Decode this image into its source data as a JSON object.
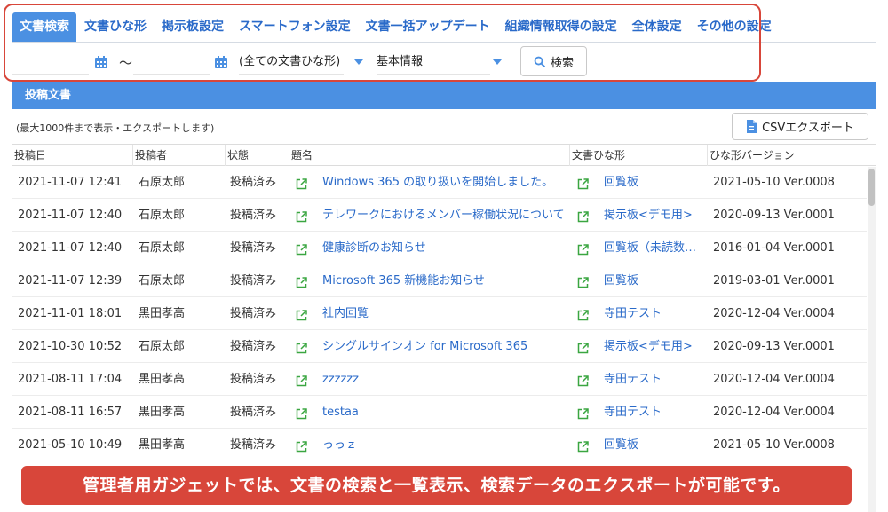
{
  "tabs": [
    {
      "label": "文書検索",
      "active": true
    },
    {
      "label": "文書ひな形",
      "active": false
    },
    {
      "label": "掲示板設定",
      "active": false
    },
    {
      "label": "スマートフォン設定",
      "active": false
    },
    {
      "label": "文書一括アップデート",
      "active": false
    },
    {
      "label": "組織情報取得の設定",
      "active": false
    },
    {
      "label": "全体設定",
      "active": false
    },
    {
      "label": "その他の設定",
      "active": false
    }
  ],
  "search": {
    "date_from": "",
    "date_separator": "〜",
    "date_to": "",
    "template_select": "(全ての文書ひな形)",
    "info_select": "基本情報",
    "search_button": "検索"
  },
  "section": {
    "title": "投稿文書",
    "note": "(最大1000件まで表示・エクスポートします)",
    "csv_button": "CSVエクスポート"
  },
  "table": {
    "headers": [
      "投稿日",
      "投稿者",
      "状態",
      "題名",
      "文書ひな形",
      "ひな形バージョン"
    ],
    "rows": [
      [
        "2021-11-07 12:41",
        "石原太郎",
        "投稿済み",
        "Windows 365 の取り扱いを開始しました。",
        "回覧板",
        "2021-05-10 Ver.0008"
      ],
      [
        "2021-11-07 12:40",
        "石原太郎",
        "投稿済み",
        "テレワークにおけるメンバー稼働状況について",
        "掲示板<デモ用>",
        "2020-09-13 Ver.0001"
      ],
      [
        "2021-11-07 12:40",
        "石原太郎",
        "投稿済み",
        "健康診断のお知らせ",
        "回覧板（未読数…",
        "2016-01-04 Ver.0001"
      ],
      [
        "2021-11-07 12:39",
        "石原太郎",
        "投稿済み",
        "Microsoft 365 新機能お知らせ",
        "回覧板",
        "2019-03-01 Ver.0001"
      ],
      [
        "2021-11-01 18:01",
        "黒田孝高",
        "投稿済み",
        "社内回覧",
        "寺田テスト",
        "2020-12-04 Ver.0004"
      ],
      [
        "2021-10-30 10:52",
        "石原太郎",
        "投稿済み",
        "シングルサインオン for Microsoft 365",
        "掲示板<デモ用>",
        "2020-09-13 Ver.0001"
      ],
      [
        "2021-08-11 17:04",
        "黒田孝高",
        "投稿済み",
        "zzzzzz",
        "寺田テスト",
        "2020-12-04 Ver.0004"
      ],
      [
        "2021-08-11 16:57",
        "黒田孝高",
        "投稿済み",
        "testaa",
        "寺田テスト",
        "2020-12-04 Ver.0004"
      ],
      [
        "2021-05-10 10:49",
        "黒田孝高",
        "投稿済み",
        "っっｚ",
        "回覧板",
        "2021-05-10 Ver.0008"
      ]
    ]
  },
  "caption": "管理者用ガジェットでは、文書の検索と一覧表示、検索データのエクスポートが可能です。",
  "colors": {
    "accent": "#4b90e2",
    "link": "#2a6ac9",
    "highlight": "#d8463a",
    "ext_icon": "#3aa641"
  }
}
